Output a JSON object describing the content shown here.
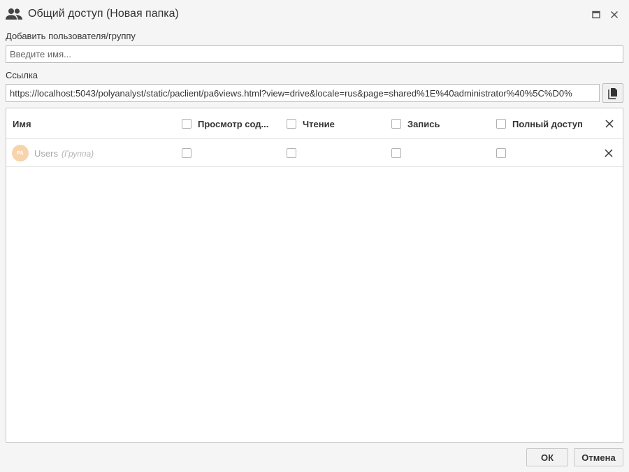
{
  "window": {
    "title": "Общий доступ (Новая папка)"
  },
  "add_user": {
    "label": "Добавить пользователя/группу",
    "placeholder": "Введите имя..."
  },
  "link": {
    "label": "Ссылка",
    "value": "https://localhost:5043/polyanalyst/static/paclient/pa6views.html?view=drive&locale=rus&page=shared%1E%40administrator%40%5C%D0%"
  },
  "table": {
    "columns": {
      "name": "Имя",
      "view": "Просмотр сод...",
      "read": "Чтение",
      "write": "Запись",
      "full": "Полный доступ"
    },
    "rows": [
      {
        "avatar": "PA",
        "name": "Users",
        "type": "(Группа)"
      }
    ]
  },
  "buttons": {
    "ok": "ОК",
    "cancel": "Отмена"
  }
}
